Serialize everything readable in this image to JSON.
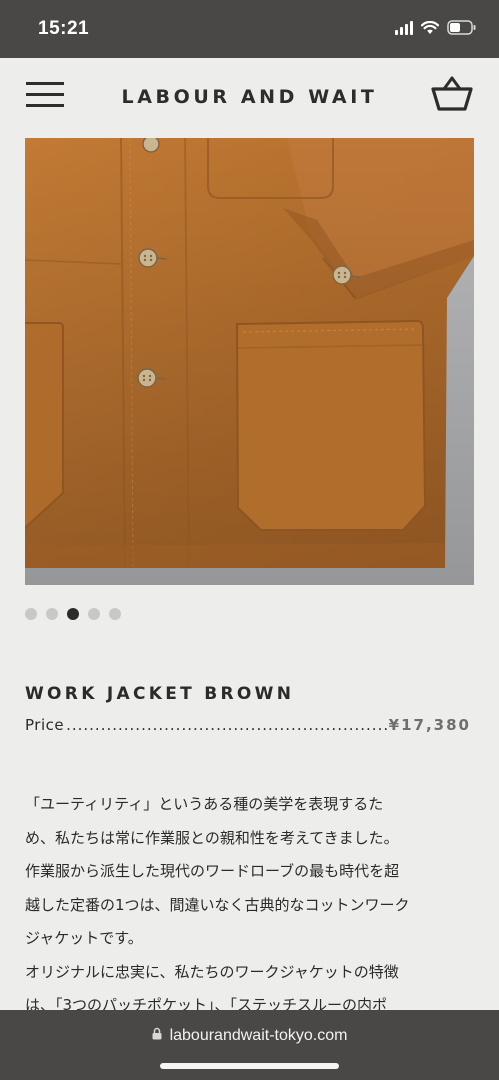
{
  "status_bar": {
    "time": "15:21",
    "icons": [
      "cellular-signal-icon",
      "wifi-icon",
      "battery-icon"
    ]
  },
  "header": {
    "brand": "LABOUR AND WAIT",
    "menu_icon": "hamburger-menu-icon",
    "cart_icon": "basket-icon"
  },
  "product": {
    "image_alt": "brown cotton work jacket close-up with buttons and patch pocket",
    "gallery": {
      "total": 5,
      "active_index": 2
    },
    "title": "WORK JACKET BROWN",
    "price_label": "Price",
    "price_leader": "..................................................................................",
    "price": "¥17,380",
    "description_lines": [
      "「ユーティリティ」というある種の美学を表現するた",
      "め、私たちは常に作業服との親和性を考えてきました。",
      "作業服から派生した現代のワードローブの最も時代を超",
      "越した定番の1つは、間違いなく古典的なコットンワーク",
      "ジャケットです。",
      "オリジナルに忠実に、私たちのワークジャケットの特徴",
      "は、「3つのパッチポケット」、「ステッチスルーの内ポ"
    ]
  },
  "browser": {
    "url": "labourandwait-tokyo.com",
    "lock_icon": "lock-icon"
  },
  "colors": {
    "background": "#ededeb",
    "system_bar": "#4a4846",
    "jacket": "#b8722f",
    "text": "#2b2b2b",
    "price": "#6f6f6d"
  }
}
